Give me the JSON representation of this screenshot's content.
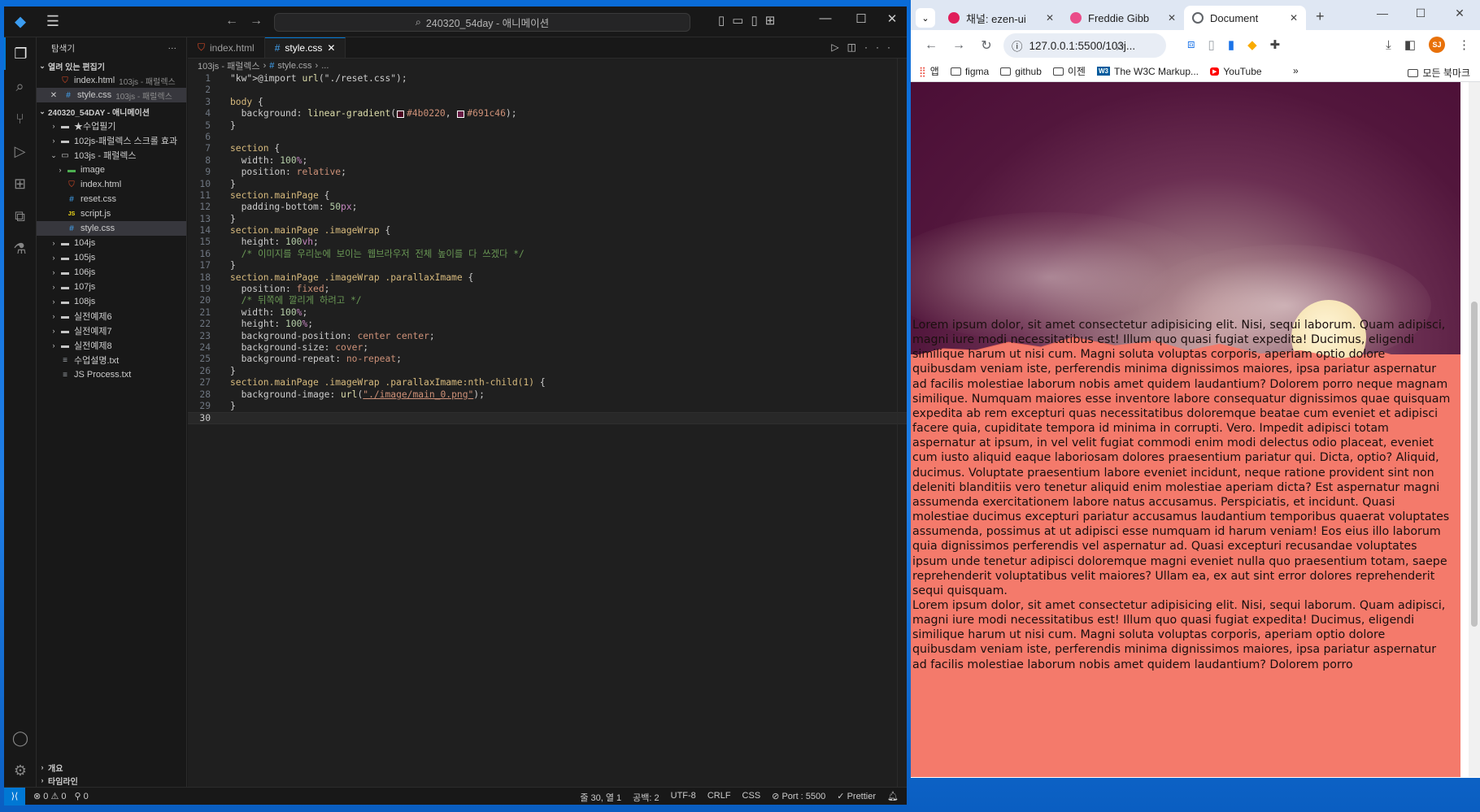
{
  "vscode": {
    "title": "240320_54day - 애니메이션",
    "explorer_title": "탐색기",
    "open_editors_label": "열려 있는 편집기",
    "open_editors": [
      {
        "name": "index.html",
        "path": "103js - 패럴렉스",
        "icon": "html"
      },
      {
        "name": "style.css",
        "path": "103js - 패럴렉스",
        "icon": "css"
      }
    ],
    "workspace_label": "240320_54DAY - 애니메이션",
    "tree": [
      {
        "name": "★수업필기",
        "type": "folder"
      },
      {
        "name": "102js-패럴렉스 스크롤 효과",
        "type": "folder"
      },
      {
        "name": "103js - 패럴렉스",
        "type": "folder-open"
      },
      {
        "name": "image",
        "type": "img-folder"
      },
      {
        "name": "index.html",
        "type": "html"
      },
      {
        "name": "reset.css",
        "type": "css"
      },
      {
        "name": "script.js",
        "type": "js"
      },
      {
        "name": "style.css",
        "type": "css"
      },
      {
        "name": "104js",
        "type": "folder"
      },
      {
        "name": "105js",
        "type": "folder"
      },
      {
        "name": "106js",
        "type": "folder"
      },
      {
        "name": "107js",
        "type": "folder"
      },
      {
        "name": "108js",
        "type": "folder"
      },
      {
        "name": "실전예제6",
        "type": "folder"
      },
      {
        "name": "실전예제7",
        "type": "folder"
      },
      {
        "name": "실전예제8",
        "type": "folder"
      },
      {
        "name": "수업설명.txt",
        "type": "txt"
      },
      {
        "name": "JS Process.txt",
        "type": "txt"
      }
    ],
    "outline_label": "개요",
    "timeline_label": "타임라인",
    "tabs": [
      {
        "label": "index.html",
        "icon": "html"
      },
      {
        "label": "style.css",
        "icon": "css"
      }
    ],
    "breadcrumb": [
      "103js - 패럴렉스",
      "style.css",
      "..."
    ],
    "code_lines": [
      "@import url(\"./reset.css\");",
      "",
      "body {",
      "  background: linear-gradient(#4b0220, #691c46);",
      "}",
      "",
      "section {",
      "  width: 100%;",
      "  position: relative;",
      "}",
      "section.mainPage {",
      "  padding-bottom: 50px;",
      "}",
      "section.mainPage .imageWrap {",
      "  height: 100vh;",
      "  /* 이미지를 우리눈에 보이는 웹브라우저 전체 높이를 다 쓰겠다 */",
      "}",
      "section.mainPage .imageWrap .parallaxImame {",
      "  position: fixed;",
      "  /* 뒤쪽에 깔리게 하려고 */",
      "  width: 100%;",
      "  height: 100%;",
      "  background-position: center center;",
      "  background-size: cover;",
      "  background-repeat: no-repeat;",
      "}",
      "section.mainPage .imageWrap .parallaxImame:nth-child(1) {",
      "  background-image: url(\"./image/main_0.png\");",
      "}",
      ""
    ],
    "swatch_colors": [
      "#4b0220",
      "#691c46"
    ],
    "status": {
      "errors": "0",
      "warnings": "0",
      "ports": "0",
      "position": "줄 30, 열 1",
      "spaces": "공백: 2",
      "encoding": "UTF-8",
      "eol": "CRLF",
      "language": "CSS",
      "port": "Port : 5500",
      "prettier": "Prettier"
    }
  },
  "chrome": {
    "tabs": [
      {
        "label": "채널: ezen-ui",
        "favicon_color": "#e01e5a"
      },
      {
        "label": "Freddie Gibb",
        "favicon_color": "#ea4c89"
      },
      {
        "label": "Document",
        "favicon_color": "#5f6368"
      }
    ],
    "address": "127.0.0.1:5500/103j...",
    "bookmarks": [
      {
        "label": "앱",
        "icon": "apps-icon"
      },
      {
        "label": "figma",
        "icon": "folder-icon"
      },
      {
        "label": "github",
        "icon": "folder-icon"
      },
      {
        "label": "이젠",
        "icon": "folder-icon"
      },
      {
        "label": "The W3C Markup...",
        "icon": "w3c-icon"
      },
      {
        "label": "YouTube",
        "icon": "youtube-icon"
      }
    ],
    "all_bookmarks": "모든 북마크",
    "avatar": "SJ",
    "page_text": [
      "Lorem ipsum dolor, sit amet consectetur adipisicing elit. Nisi, sequi laborum. Quam adipisci, magni iure modi necessitatibus est! Illum quo quasi fugiat expedita! Ducimus, eligendi similique harum ut nisi cum. Magni soluta voluptas corporis, aperiam optio dolore quibusdam veniam iste, perferendis minima dignissimos maiores, ipsa pariatur aspernatur ad facilis molestiae laborum nobis amet quidem laudantium? Dolorem porro neque magnam similique. Numquam maiores esse inventore labore consequatur dignissimos quae quisquam expedita ab rem excepturi quas necessitatibus doloremque beatae cum eveniet et adipisci facere quia, cupiditate tempora id minima in corrupti. Vero. Impedit adipisci totam aspernatur at ipsum, in vel velit fugiat commodi enim modi delectus odio placeat, eveniet cum iusto aliquid eaque laboriosam dolores praesentium pariatur qui. Dicta, optio? Aliquid, ducimus. Voluptate praesentium labore eveniet incidunt, neque ratione provident sint non deleniti blanditiis vero tenetur aliquid enim molestiae aperiam dicta? Est aspernatur magni assumenda exercitationem labore natus accusamus. Perspiciatis, et incidunt. Quasi molestiae ducimus excepturi pariatur accusamus laudantium temporibus quaerat voluptates assumenda, possimus at ut adipisci esse numquam id harum veniam! Eos eius illo laborum quia dignissimos perferendis vel aspernatur ad. Quasi excepturi recusandae voluptates ipsum unde tenetur adipisci doloremque magni eveniet nulla quo praesentium totam, saepe reprehenderit voluptatibus velit maiores? Ullam ea, ex aut sint error dolores reprehenderit sequi quisquam.",
      "Lorem ipsum dolor, sit amet consectetur adipisicing elit. Nisi, sequi laborum. Quam adipisci, magni iure modi necessitatibus est! Illum quo quasi fugiat expedita! Ducimus, eligendi similique harum ut nisi cum. Magni soluta voluptas corporis, aperiam optio dolore quibusdam veniam iste, perferendis minima dignissimos maiores, ipsa pariatur aspernatur ad facilis molestiae laborum nobis amet quidem laudantium? Dolorem porro"
    ]
  }
}
